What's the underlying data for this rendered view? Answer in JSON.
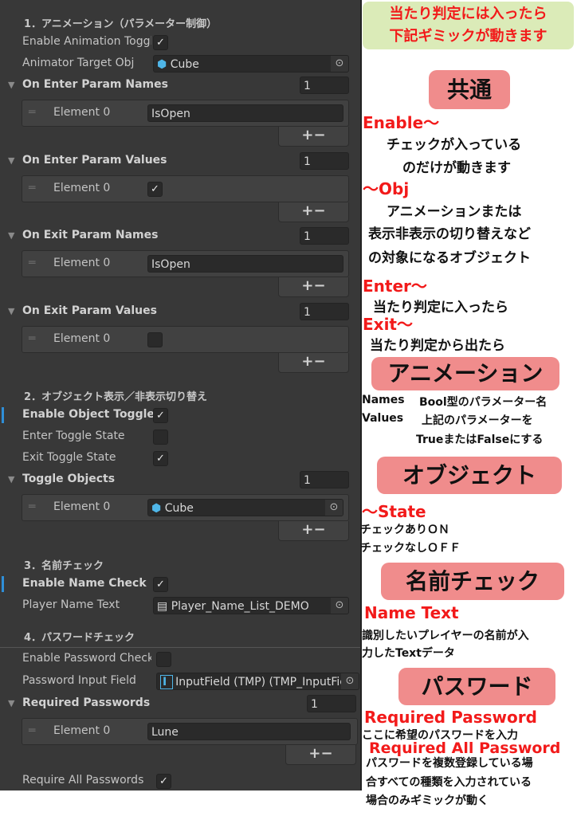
{
  "inspector": {
    "sec1": {
      "header": "1．アニメーション（パラメーター制御）",
      "enable_label": "Enable Animation Toggle",
      "enable_checked": true,
      "target_label": "Animator Target Obj",
      "target_value": "Cube",
      "lists": [
        {
          "label": "On Enter Param Names",
          "count": "1",
          "element": "Element 0",
          "value": "IsOpen",
          "type": "text"
        },
        {
          "label": "On Enter Param Values",
          "count": "1",
          "element": "Element 0",
          "checked": true,
          "type": "bool"
        },
        {
          "label": "On Exit Param Names",
          "count": "1",
          "element": "Element 0",
          "value": "IsOpen",
          "type": "text"
        },
        {
          "label": "On Exit Param Values",
          "count": "1",
          "element": "Element 0",
          "checked": false,
          "type": "bool"
        }
      ]
    },
    "sec2": {
      "header": "2．オブジェクト表示／非表示切り替え",
      "enable_label": "Enable Object Toggle",
      "enable_checked": true,
      "enter_label": "Enter Toggle State",
      "enter_checked": false,
      "exit_label": "Exit Toggle State",
      "exit_checked": true,
      "list": {
        "label": "Toggle Objects",
        "count": "1",
        "element": "Element 0",
        "value": "Cube"
      }
    },
    "sec3": {
      "header": "3．名前チェック",
      "enable_label": "Enable Name Check",
      "enable_checked": true,
      "text_label": "Player Name Text",
      "text_value": "Player_Name_List_DEMO"
    },
    "sec4": {
      "header": "4．パスワードチェック",
      "enable_label": "Enable Password Check",
      "enable_checked": false,
      "input_label": "Password Input Field",
      "input_value": "InputField (TMP) (TMP_InputField)",
      "list": {
        "label": "Required Passwords",
        "count": "1",
        "element": "Element 0",
        "value": "Lune"
      },
      "require_all_label": "Require All Passwords",
      "require_all_checked": true
    },
    "plus": "+",
    "minus": "−",
    "check": "✓",
    "grip": "═",
    "triangle": "▼",
    "picker": "⊙"
  },
  "notes": {
    "banner": [
      "当たり判定には入ったら",
      "下記ギミックが動きます"
    ],
    "common_title": "共通",
    "enable_key": "Enable〜",
    "enable_desc": [
      "チェックが入っている",
      "のだけが動きます"
    ],
    "obj_key": "〜Obj",
    "obj_desc": [
      "アニメーションまたは",
      "表示非表示の切り替えなど",
      "の対象になるオブジェクト"
    ],
    "enter_key": "Enter〜",
    "enter_desc": "当たり判定に入ったら",
    "exit_key": "Exit〜",
    "exit_desc": "当たり判定から出たら",
    "anim_title": "アニメーション",
    "names_key": "Names",
    "names_desc": "Bool型のパラメーター名",
    "values_key": "Values",
    "values_desc": [
      "上記のパラメーターを",
      "TrueまたはFalseにする"
    ],
    "object_title": "オブジェクト",
    "state_key": "〜State",
    "state_desc": [
      "チェックありＯＮ",
      "チェックなしＯＦＦ"
    ],
    "name_title": "名前チェック",
    "nametext_key": "Name Text",
    "nametext_desc": [
      "識別したいプレイヤーの名前が入",
      "力したTextデータ"
    ],
    "password_title": "パスワード",
    "reqpw_key": "Required Password",
    "reqpw_desc": "ここに希望のパスワードを入力",
    "reqall_key": "Required All Password",
    "reqall_desc": [
      "パスワードを複数登録している場",
      "合すべての種類を入力されている",
      "場合のみギミックが動く"
    ]
  },
  "colors": {
    "panel": "#383838",
    "accent_red": "#f21a1a",
    "pink": "#f08c8c",
    "banner": "#dbebb8"
  }
}
